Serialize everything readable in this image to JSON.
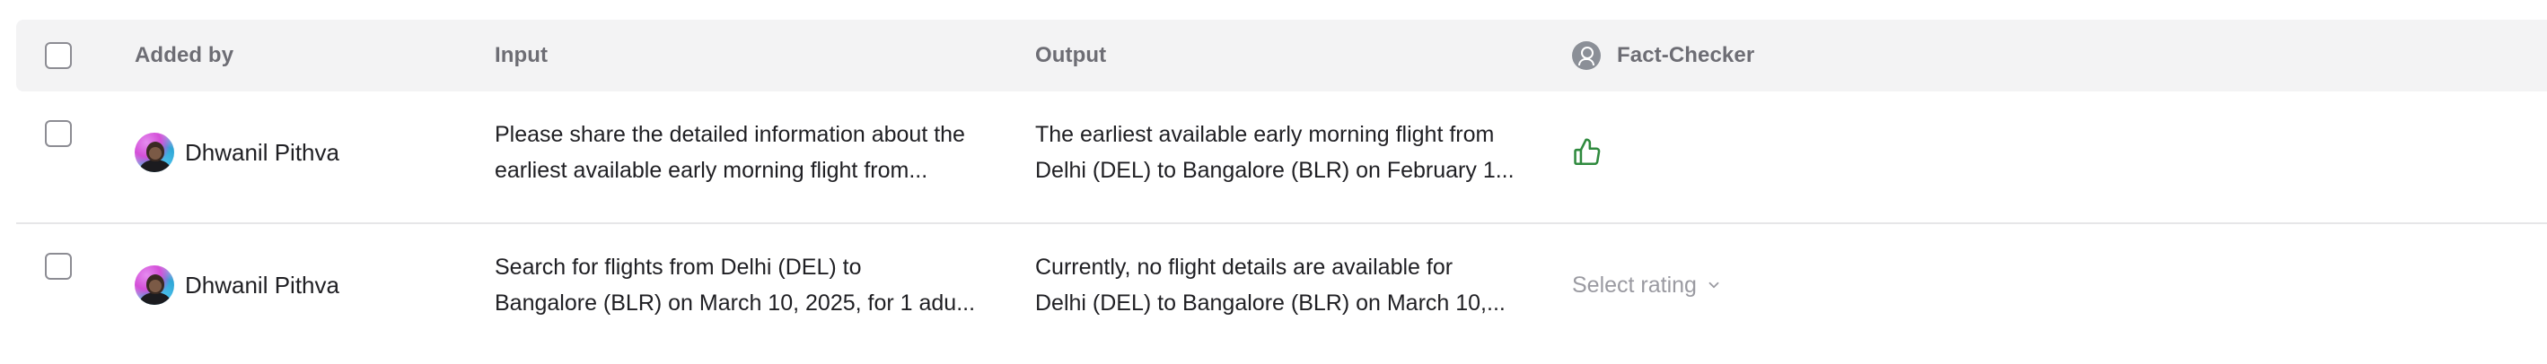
{
  "header": {
    "added_by": "Added by",
    "input": "Input",
    "output": "Output",
    "fact_checker": "Fact-Checker"
  },
  "rows": [
    {
      "user": "Dhwanil Pithva",
      "input_line1": "Please share the detailed information about the",
      "input_line2": "earliest available early morning flight from...",
      "output_line1": "The earliest available early morning flight from",
      "output_line2": "Delhi (DEL) to Bangalore (BLR) on February 1...",
      "rating_icon": "thumbs-up-icon",
      "rating_color": "#2f8a3e"
    },
    {
      "user": "Dhwanil Pithva",
      "input_line1": "Search for flights from Delhi (DEL) to",
      "input_line2": "Bangalore (BLR) on March 10, 2025, for 1 adu...",
      "output_line1": "Currently, no flight details are available for",
      "output_line2": "Delhi (DEL) to Bangalore (BLR) on March 10,...",
      "rating_placeholder": "Select rating"
    }
  ]
}
